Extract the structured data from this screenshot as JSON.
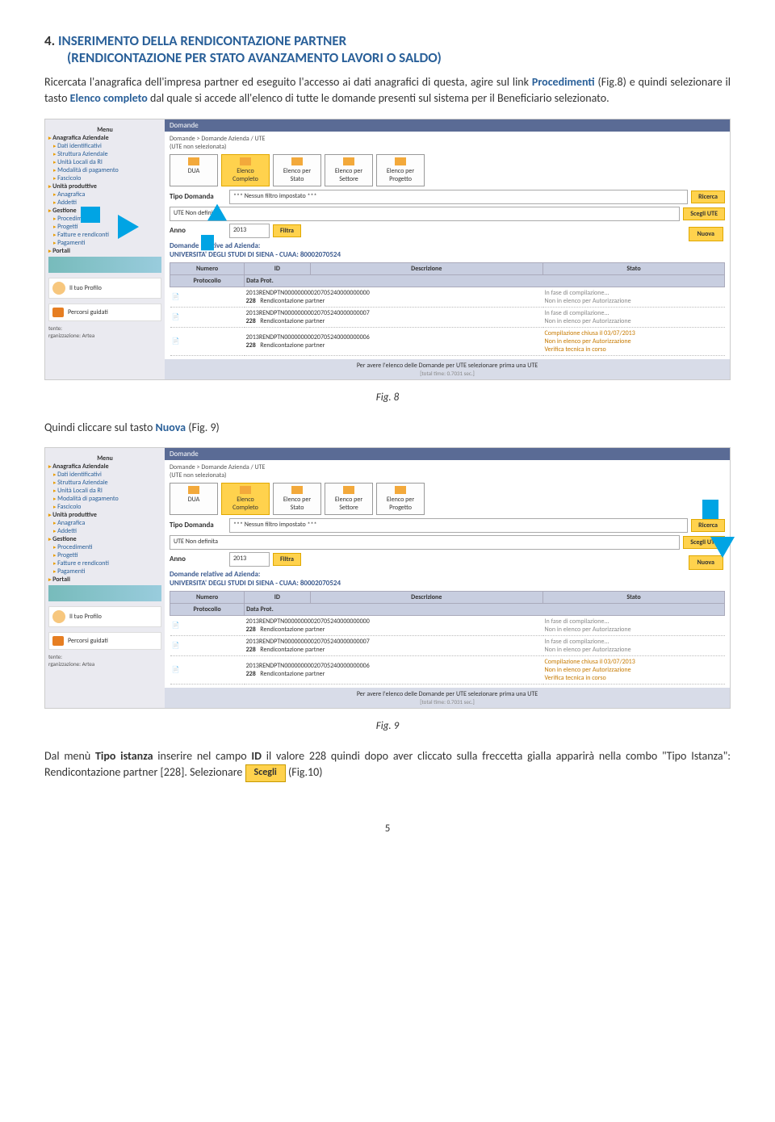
{
  "section": {
    "number": "4.",
    "title_part1": "INSERIMENTO DELLA RENDICONTAZIONE PARTNER",
    "title_part2": "(RENDICONTAZIONE PER STATO AVANZAMENTO LAVORI O SALDO)"
  },
  "para1_a": "Ricercata l'anagrafica dell'impresa partner ed eseguito l'accesso ai dati anagrafici di questa, agire sul link ",
  "para1_link": "Procedimenti",
  "para1_b": " (Fig.8) e quindi selezionare il tasto ",
  "para1_link2": "Elenco completo",
  "para1_c": " dal quale si accede all'elenco di tutte le domande presenti sul sistema per il Beneficiario selezionato.",
  "fig8_label": "Fig. 8",
  "para2_a": "Quindi cliccare sul tasto ",
  "para2_link": "Nuova",
  "para2_b": " (Fig. 9)",
  "fig9_label": "Fig. 9",
  "para3_a": "Dal menù ",
  "para3_b1": "Tipo istanza",
  "para3_c": " inserire nel campo ",
  "para3_b2": "ID",
  "para3_d": " il valore 228 quindi dopo aver cliccato sulla freccetta gialla apparirà nella combo \"Tipo Istanza\": Rendicontazione partner [228]. Selezionare ",
  "para3_btn": "Scegli",
  "para3_e": " (Fig.10)",
  "page_number": "5",
  "shot": {
    "menu_h": "Menu",
    "dom_h": "Domande",
    "breadcrumb": "Domande > Domande Azienda / UTE",
    "ute_sub": "(UTE non selezionata)",
    "sidebar": {
      "s1": "Anagrafica Aziendale",
      "i1a": "Dati identificativi",
      "i1b": "Struttura Aziendale",
      "i1c": "Unità Locali da RI",
      "i1d": "Modalità di pagamento",
      "i1e": "Fascicolo",
      "s2": "Unità produttive",
      "i2a": "Anagrafica",
      "i2b": "Addetti",
      "s3": "Gestione",
      "i3a": "Procedimenti",
      "i3b": "Progetti",
      "i3c": "Fatture e rendiconti",
      "i3d": "Pagamenti",
      "s4": "Portali",
      "prof": "Il tuo Profilo",
      "perc": "Percorsi guidati",
      "org": "rganizzazione: Artea",
      "tente": "tente:"
    },
    "tb": {
      "dua": "DUA",
      "elcomp": "Elenco Completo",
      "elstato": "Elenco per Stato",
      "elsett": "Elenco per Settore",
      "elprog": "Elenco per Progetto"
    },
    "lbl_tipo": "Tipo Domanda",
    "val_tipo": "*** Nessun filtro impostato ***",
    "btn_ricerca": "Ricerca",
    "val_ute": "UTE Non definita",
    "btn_scegli_ute": "Scegli UTE",
    "lbl_anno": "Anno",
    "val_anno": "2013",
    "btn_filtra": "Filtra",
    "az_lbl": "Domande relative ad Azienda:",
    "az_val": "UNIVERSITA' DEGLI STUDI DI SIENA - CUAA: 80002070524",
    "btn_nuova": "Nuova",
    "th_num": "Numero",
    "th_id": "ID",
    "th_desc": "Descrizione",
    "th_stato": "Stato",
    "th_prot": "Protocollo",
    "th_data": "Data Prot.",
    "rows": [
      {
        "id": "2013RENDPTN00000000020705240000000000",
        "code": "228",
        "desc": "Rendicontazione partner",
        "s1": "In fase di compilazione...",
        "s2": "Non in elenco per Autorizzazione"
      },
      {
        "id": "2013RENDPTN00000000020705240000000007",
        "code": "228",
        "desc": "Rendicontazione partner",
        "s1": "In fase di compilazione...",
        "s2": "Non in elenco per Autorizzazione"
      },
      {
        "id": "2013RENDPTN00000000020705240000000006",
        "code": "228",
        "desc": "Rendicontazione partner",
        "s1": "Compilazione chiusa il 03/07/2013",
        "s2": "Non in elenco per Autorizzazione",
        "s3": "Verifica tecnica in corso"
      }
    ],
    "footer": "Per avere l'elenco delle Domande per UTE selezionare prima una UTE",
    "time": "[total time: 0.7031 sec.]"
  }
}
